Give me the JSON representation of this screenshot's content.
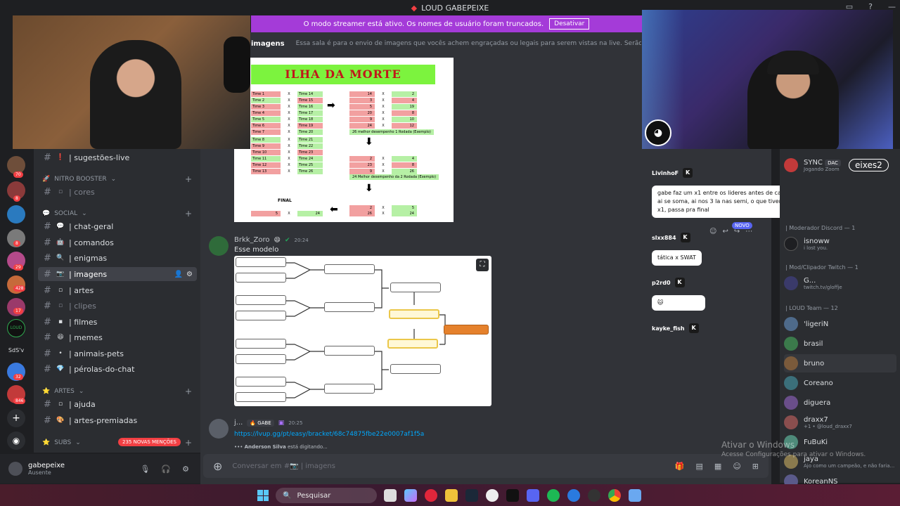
{
  "window": {
    "title": "LOUD GABEPEIXE"
  },
  "banner": {
    "text": "O modo streamer está ativo. Os nomes de usuário foram truncados.",
    "button": "Desativar"
  },
  "channel_header": {
    "name": "imagens",
    "topic": "Essa sala é para o envio de imagens que vocês achem engraçadas ou legais para serem vistas na live. Serão apagados prints de out"
  },
  "rail": {
    "badges": [
      "70",
      "8",
      "8",
      "29",
      "428",
      "17",
      "32",
      "846"
    ],
    "texts": {
      "loud": "LOUD",
      "sdsv": "SdS'v"
    }
  },
  "sidebar": {
    "categories": {
      "nitro": "NITRO BOOSTER",
      "social": "SOCIAL",
      "artes": "ARTES",
      "subs": "SUBS"
    },
    "channels": {
      "sugestoes": "| sugestões-live",
      "cores": "| cores",
      "chat_geral": "| chat-geral",
      "comandos": "| comandos",
      "enigmas": "| enigmas",
      "imagens": "| imagens",
      "artes": "| artes",
      "clipes": "| clipes",
      "filmes": "| filmes",
      "memes": "| memes",
      "animais": "| animais-pets",
      "perolas": "| pérolas-do-chat",
      "ajuda": "| ajuda",
      "artes_premiadas": "| artes-premiadas"
    },
    "mentions_badge": "235 NOVAS MENÇÕES"
  },
  "user_panel": {
    "name": "gabepeixe",
    "status": "Ausente"
  },
  "sheet": {
    "title": "ILHA DA MORTE",
    "rows": [
      {
        "a": "Time 1",
        "b": "Time 14",
        "n1": "14",
        "n2": "2"
      },
      {
        "a": "Time 2",
        "b": "Time 15",
        "n1": "3",
        "n2": "4"
      },
      {
        "a": "Time 3",
        "b": "Time 16",
        "n1": "5",
        "n2": "19"
      },
      {
        "a": "Time 4",
        "b": "Time 17",
        "n1": "20",
        "n2": "8"
      },
      {
        "a": "Time 5",
        "b": "Time 18",
        "n1": "9",
        "n2": "10"
      },
      {
        "a": "Time 6",
        "b": "Time 19",
        "n1": "24",
        "n2": "12"
      },
      {
        "a": "Time 7",
        "b": "Time 20",
        "n1": "",
        "n2": ""
      },
      {
        "a": "Time 8",
        "b": "Time 21",
        "n1": "",
        "n2": ""
      },
      {
        "a": "Time 9",
        "b": "Time 22",
        "n1": "",
        "n2": ""
      },
      {
        "a": "Time 10",
        "b": "Time 23",
        "n1": "",
        "n2": ""
      },
      {
        "a": "Time 11",
        "b": "Time 24",
        "n1": "2",
        "n2": "4"
      },
      {
        "a": "Time 12",
        "b": "Time 25",
        "n1": "23",
        "n2": "8"
      },
      {
        "a": "Time 13",
        "b": "Time 26",
        "n1": "9",
        "n2": "26"
      }
    ],
    "note1": "26 melhor desempenho 1 Rodada (Exemplo)",
    "note2": "24 Melhor desempenho da 2 Rodada (Exemplo)",
    "final_label": "FINAL",
    "final_row": {
      "a": "5",
      "b": "24",
      "n1": "2",
      "n2": "5"
    },
    "final_row2": {
      "n1": "26",
      "n2": "24"
    },
    "x": "X"
  },
  "messages": [
    {
      "author": "Brkk_Zoro",
      "time": "20:24",
      "text": "Esse modelo",
      "avatar_color": "#2f6b3a"
    },
    {
      "author": "j...",
      "tag": "GABE",
      "time": "20:25",
      "link": "https://lvup.gg/pt/easy/bracket/68c74875fbe22e0007af1f5a",
      "avatar_color": "#5a5f68"
    }
  ],
  "typing": {
    "user": "Anderson Silva",
    "suffix": " está digitando..."
  },
  "composer": {
    "placeholder": "Conversar em #📷 | imagens"
  },
  "stream_chat": {
    "messages": [
      {
        "user": "LivinhoF",
        "text": "gabe faz um x1 entre os lideres antes de cada confronto, ai se soma, ai nos 3 la nas semi, o que tiver mais win de x1, passa pra final"
      },
      {
        "user": "slxx884",
        "text": "tática x SWAT"
      },
      {
        "user": "p2rd0",
        "text": "🐱"
      },
      {
        "user": "kayke_fish",
        "text": ""
      }
    ],
    "novo_badge": "NOVO"
  },
  "members": {
    "top_user": {
      "name": "SYNC",
      "tag": "DAC",
      "sub": "Jogando Zoom",
      "overlay": "eixes2"
    },
    "categories": {
      "mod_discord": "| Moderador Discord — 1",
      "mod_clip": "| Mod/Clipador Twitch — 1",
      "loud_team": "| LOUD Team — 12"
    },
    "mod_discord": [
      {
        "name": "isnoww",
        "sub": "i lost you."
      }
    ],
    "mod_clip": [
      {
        "name": "G...",
        "sub": "twitch.tv/gloffje"
      }
    ],
    "team": [
      {
        "name": "'ligeriN",
        "sub": "",
        "color": "#4e6a8a"
      },
      {
        "name": "brasil",
        "sub": "",
        "color": "#3b7a4b"
      },
      {
        "name": "bruno",
        "sub": "",
        "color": "#7a5a3b"
      },
      {
        "name": "Coreano",
        "sub": "",
        "color": "#3b6f7a"
      },
      {
        "name": "diguera",
        "sub": "",
        "color": "#6a4e8a"
      },
      {
        "name": "draxx7",
        "sub": "+1 • @loud_draxx7",
        "color": "#8a4e4e"
      },
      {
        "name": "FuBuKi",
        "sub": "",
        "color": "#4e8a7a"
      },
      {
        "name": "jaya",
        "sub": "Ajo como um campeão, e não faria...",
        "color": "#8a7a4e"
      },
      {
        "name": "KoreanNS",
        "sub": "",
        "color": "#5a5a8a"
      }
    ]
  },
  "windows_watermark": {
    "title": "Ativar o Windows",
    "sub": "Acesse Configurações para ativar o Windows."
  },
  "taskbar": {
    "search_placeholder": "Pesquisar"
  },
  "colors": {
    "blurple": "#5865f2",
    "discord_bg": "#313338",
    "sidebar_bg": "#2b2d31",
    "banner": "#a43bd8",
    "link": "#00a8fc",
    "mention_red": "#f23f43"
  }
}
